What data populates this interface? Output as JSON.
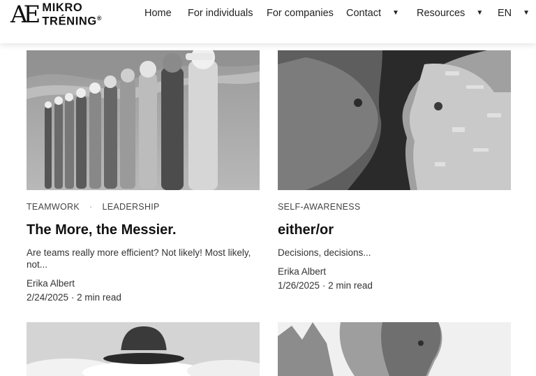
{
  "logo": {
    "mark": "AE",
    "line1": "MIKRO",
    "line2": "TRÉNING",
    "reg": "®"
  },
  "nav": {
    "items": [
      {
        "label": "Home"
      },
      {
        "label": "For individuals"
      },
      {
        "label": "For companies"
      },
      {
        "label": "Contact"
      },
      {
        "label": "Resources"
      },
      {
        "label": "EN"
      }
    ],
    "caret": "▼"
  },
  "posts": [
    {
      "tags": [
        "TEAMWORK",
        "LEADERSHIP"
      ],
      "tag_separator": "·",
      "title": "The More, the Messier.",
      "excerpt": "Are teams really more efficient? Not likely! Most likely, not...",
      "author": "Erika Albert",
      "date": "2/24/2025",
      "read_time": "2 min read"
    },
    {
      "tags": [
        "SELF-AWARENESS"
      ],
      "title": "either/or",
      "excerpt": "Decisions, decisions...",
      "author": "Erika Albert",
      "date": "1/26/2025",
      "read_time": "2 min read"
    }
  ],
  "meta_separator": " · "
}
